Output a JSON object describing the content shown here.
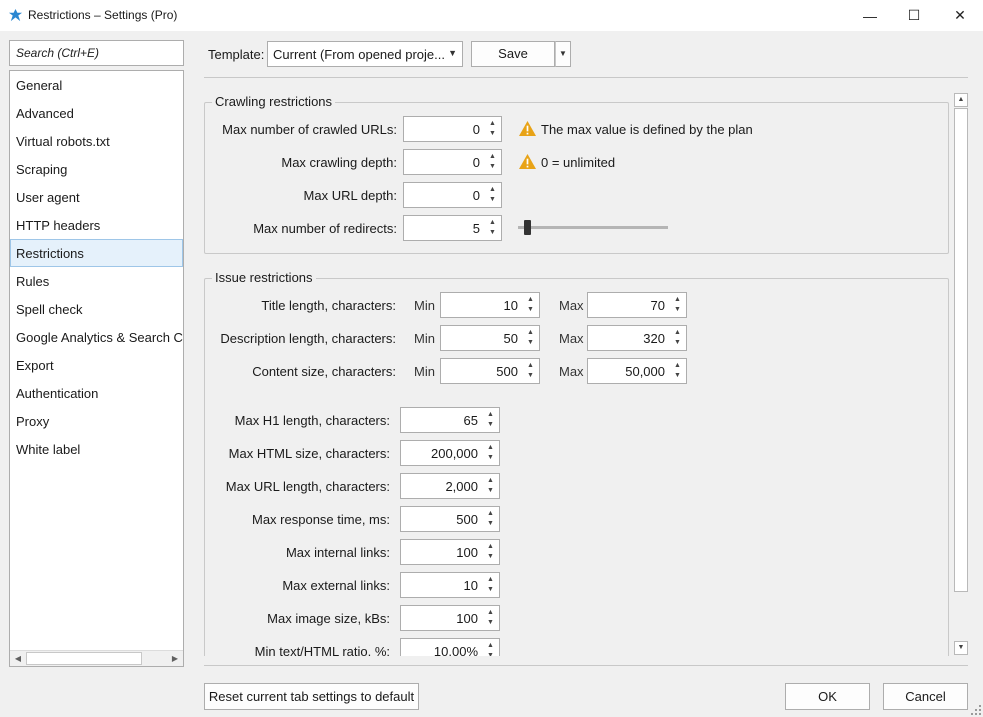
{
  "window": {
    "title": "Restrictions – Settings (Pro)",
    "minimize_glyph": "—",
    "maximize_glyph": "☐",
    "close_glyph": "✕"
  },
  "sidebar": {
    "search_placeholder": "Search (Ctrl+E)",
    "items": [
      {
        "label": "General"
      },
      {
        "label": "Advanced"
      },
      {
        "label": "Virtual robots.txt"
      },
      {
        "label": "Scraping"
      },
      {
        "label": "User agent"
      },
      {
        "label": "HTTP headers"
      },
      {
        "label": "Restrictions",
        "selected": true
      },
      {
        "label": "Rules"
      },
      {
        "label": "Spell check"
      },
      {
        "label": "Google Analytics & Search Console"
      },
      {
        "label": "Export"
      },
      {
        "label": "Authentication"
      },
      {
        "label": "Proxy"
      },
      {
        "label": "White label"
      }
    ]
  },
  "toolbar": {
    "template_label": "Template:",
    "template_value": "Current (From opened proje...",
    "save_label": "Save"
  },
  "crawling": {
    "title": "Crawling restrictions",
    "rows": [
      {
        "label": "Max number of crawled URLs:",
        "value": "0"
      },
      {
        "label": "Max crawling depth:",
        "value": "0"
      },
      {
        "label": "Max URL depth:",
        "value": "0"
      },
      {
        "label": "Max number of redirects:",
        "value": "5"
      }
    ],
    "note_plan": "The max value is defined by the plan",
    "note_unlimited": "0 = unlimited",
    "redirects_slider_level": 0.05
  },
  "issues": {
    "title": "Issue restrictions",
    "min_label": "Min",
    "max_label": "Max",
    "ranges": [
      {
        "label": "Title length, characters:",
        "min": "10",
        "max": "70"
      },
      {
        "label": "Description length, characters:",
        "min": "50",
        "max": "320"
      },
      {
        "label": "Content size, characters:",
        "min": "500",
        "max": "50,000"
      }
    ],
    "singles": [
      {
        "label": "Max H1 length, characters:",
        "value": "65"
      },
      {
        "label": "Max HTML size, characters:",
        "value": "200,000"
      },
      {
        "label": "Max URL length, characters:",
        "value": "2,000"
      },
      {
        "label": "Max response time, ms:",
        "value": "500"
      },
      {
        "label": "Max internal links:",
        "value": "100"
      },
      {
        "label": "Max external links:",
        "value": "10"
      },
      {
        "label": "Max image size, kBs:",
        "value": "100"
      },
      {
        "label": "Min text/HTML ratio, %:",
        "value": "10.00%"
      }
    ]
  },
  "footer": {
    "reset_label": "Reset current tab settings to default",
    "ok_label": "OK",
    "cancel_label": "Cancel"
  },
  "colors": {
    "warning": "#e8a317",
    "selection_bg": "#e5f1fb",
    "selection_border": "#9ec6e8"
  }
}
